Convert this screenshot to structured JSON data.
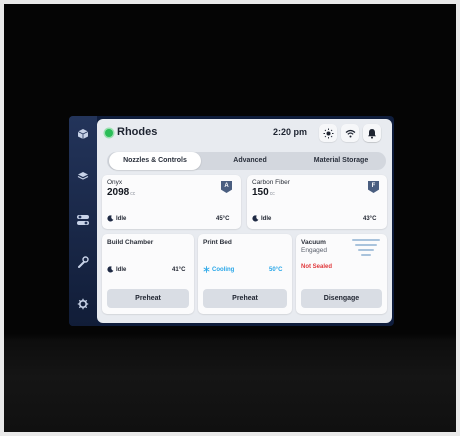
{
  "header": {
    "printer_name": "Rhodes",
    "time": "2:20 pm",
    "status_color": "#2bbd58"
  },
  "sidebar": {
    "icons": [
      "cube-icon",
      "layers-icon",
      "toggles-icon",
      "wrench-icon",
      "gear-icon"
    ]
  },
  "tabs": [
    {
      "label": "Nozzles & Controls",
      "active": true
    },
    {
      "label": "Advanced",
      "active": false
    },
    {
      "label": "Material Storage",
      "active": false
    }
  ],
  "nozzles": [
    {
      "material": "Onyx",
      "volume": "2098",
      "unit": "cc",
      "badge": "A",
      "status": "Idle",
      "temp": "45°C"
    },
    {
      "material": "Carbon Fiber",
      "volume": "150",
      "unit": "cc",
      "badge": "F",
      "status": "Idle",
      "temp": "43°C"
    }
  ],
  "build_chamber": {
    "title": "Build Chamber",
    "status": "Idle",
    "temp": "41°C",
    "button": "Preheat"
  },
  "print_bed": {
    "title": "Print Bed",
    "status": "Cooling",
    "temp": "50°C",
    "button": "Preheat",
    "accent": "#27a6e8"
  },
  "vacuum": {
    "title": "Vacuum",
    "state": "Engaged",
    "seal": "Not Sealed",
    "button": "Disengage",
    "alert_color": "#e0383b"
  }
}
